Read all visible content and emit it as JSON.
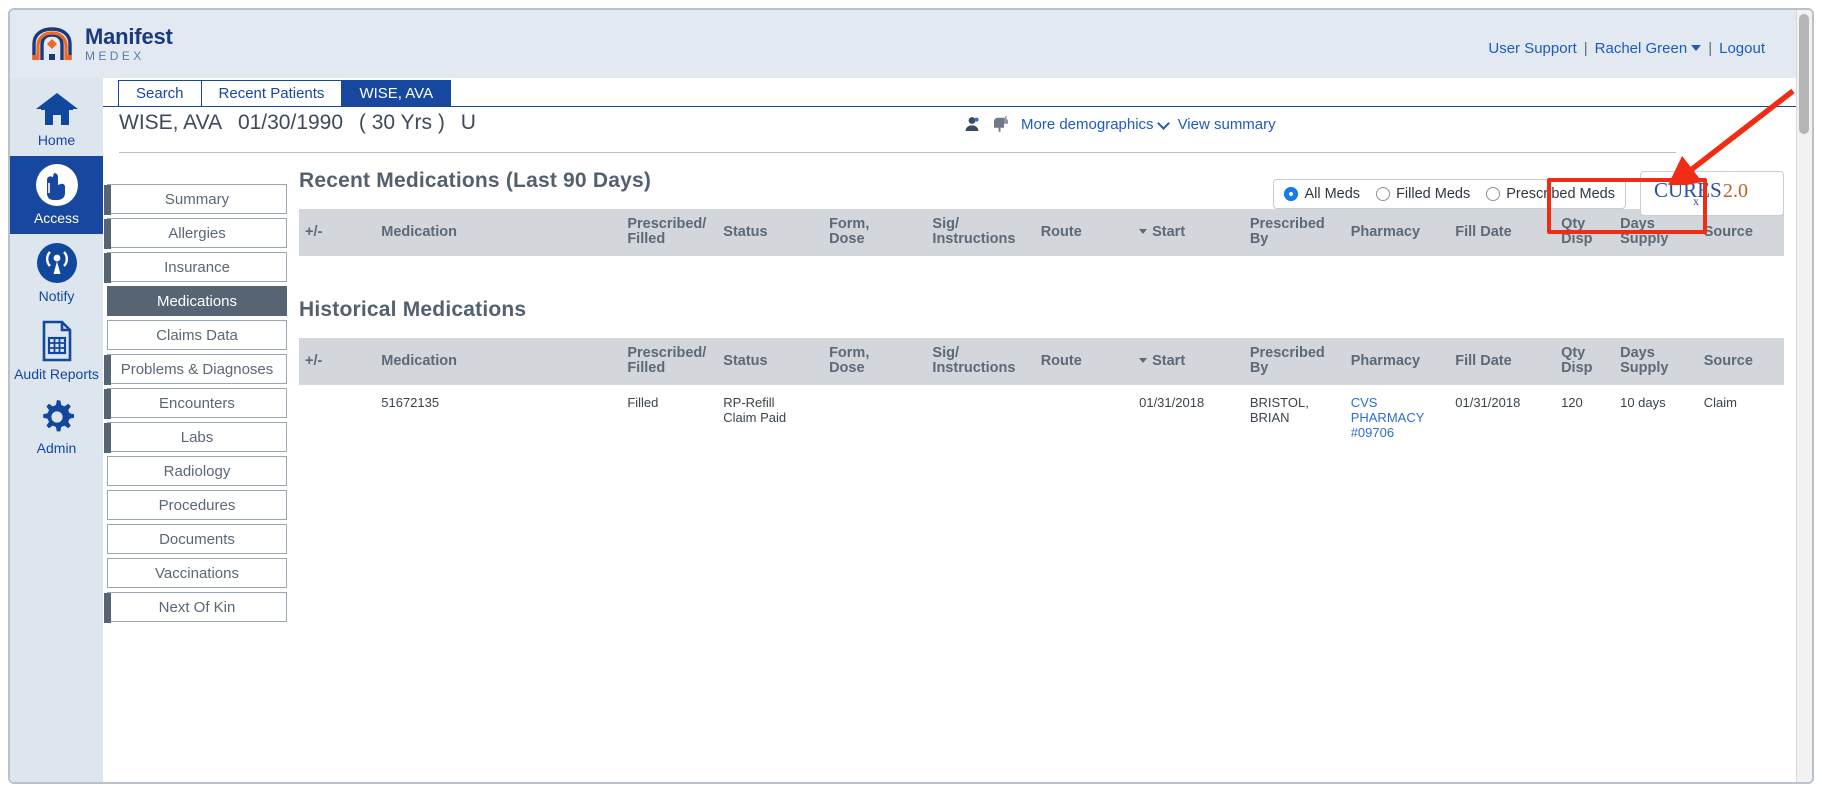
{
  "brand": {
    "name": "Manifest",
    "sub": "MEDEX",
    "logo_blue": "#1a3a7c",
    "logo_orange": "#f26522"
  },
  "header": {
    "user_support": "User Support",
    "separator": "|",
    "user_name": "Rachel Green",
    "logout": "Logout"
  },
  "tabs": [
    {
      "label": "Search",
      "active": false
    },
    {
      "label": "Recent Patients",
      "active": false
    },
    {
      "label": "WISE, AVA",
      "active": true
    }
  ],
  "rail": [
    {
      "label": "Home",
      "icon": "home-icon",
      "active": false
    },
    {
      "label": "Access",
      "icon": "access-hand-icon",
      "active": true
    },
    {
      "label": "Notify",
      "icon": "notify-broadcast-icon",
      "active": false
    },
    {
      "label": "Audit Reports",
      "icon": "audit-report-icon",
      "active": false
    },
    {
      "label": "Admin",
      "icon": "gear-icon",
      "active": false
    }
  ],
  "patient": {
    "name": "WISE, AVA",
    "dob": "01/30/1990",
    "age": "( 30 Yrs )",
    "sex": "U",
    "more_demographics": "More demographics",
    "view_summary": "View summary"
  },
  "subnav": [
    {
      "label": "Summary",
      "active": false,
      "accent": true
    },
    {
      "label": "Allergies",
      "active": false,
      "accent": true
    },
    {
      "label": "Insurance",
      "active": false,
      "accent": true
    },
    {
      "label": "Medications",
      "active": true,
      "accent": false
    },
    {
      "label": "Claims Data",
      "active": false,
      "accent": false
    },
    {
      "label": "Problems & Diagnoses",
      "active": false,
      "accent": true
    },
    {
      "label": "Encounters",
      "active": false,
      "accent": true
    },
    {
      "label": "Labs",
      "active": false,
      "accent": true
    },
    {
      "label": "Radiology",
      "active": false,
      "accent": false
    },
    {
      "label": "Procedures",
      "active": false,
      "accent": false
    },
    {
      "label": "Documents",
      "active": false,
      "accent": false
    },
    {
      "label": "Vaccinations",
      "active": false,
      "accent": false
    },
    {
      "label": "Next Of Kin",
      "active": false,
      "accent": true
    }
  ],
  "filters": {
    "options": [
      {
        "label": "All Meds",
        "selected": true
      },
      {
        "label": "Filled Meds",
        "selected": false
      },
      {
        "label": "Prescribed Meds",
        "selected": false
      }
    ],
    "cures_button": {
      "cures": "CURES",
      "sub": "x",
      "version": "2.0"
    }
  },
  "recent": {
    "title": "Recent Medications (Last 90 Days)",
    "columns": [
      "+/-",
      "Medication",
      "Prescribed/ Filled",
      "Status",
      "Form, Dose",
      "Sig/ Instructions",
      "Route",
      "Start",
      "Prescribed By",
      "Pharmacy",
      "Fill Date",
      "Qty Disp",
      "Days Supply",
      "Source"
    ],
    "sort_column": "Start",
    "rows": []
  },
  "historical": {
    "title": "Historical Medications",
    "columns": [
      "+/-",
      "Medication",
      "Prescribed/ Filled",
      "Status",
      "Form, Dose",
      "Sig/ Instructions",
      "Route",
      "Start",
      "Prescribed By",
      "Pharmacy",
      "Fill Date",
      "Qty Disp",
      "Days Supply",
      "Source"
    ],
    "sort_column": "Start",
    "rows": [
      {
        "plusminus": "",
        "medication": "51672135",
        "prescribed_filled": "Filled",
        "status": "RP-Refill Claim Paid",
        "form_dose": "",
        "sig": "",
        "route": "",
        "start": "01/31/2018",
        "prescribed_by": "BRISTOL, BRIAN",
        "pharmacy": "CVS PHARMACY #09706",
        "fill_date": "01/31/2018",
        "qty_disp": "120",
        "days_supply": "10 days",
        "source": "Claim"
      }
    ]
  },
  "column_labels": {
    "plusminus": "+/-",
    "medication": "Medication",
    "prescribed_filled_l1": "Prescribed/",
    "prescribed_filled_l2": "Filled",
    "status": "Status",
    "form_l1": "Form,",
    "form_l2": "Dose",
    "sig_l1": "Sig/",
    "sig_l2": "Instructions",
    "route": "Route",
    "start": "Start",
    "prescribed_by_l1": "Prescribed",
    "prescribed_by_l2": "By",
    "pharmacy": "Pharmacy",
    "fill_date": "Fill Date",
    "qty_l1": "Qty",
    "qty_l2": "Disp",
    "days_l1": "Days",
    "days_l2": "Supply",
    "source": "Source"
  },
  "annotation": {
    "color": "#f02c14",
    "target": "cures-2.0-button"
  }
}
